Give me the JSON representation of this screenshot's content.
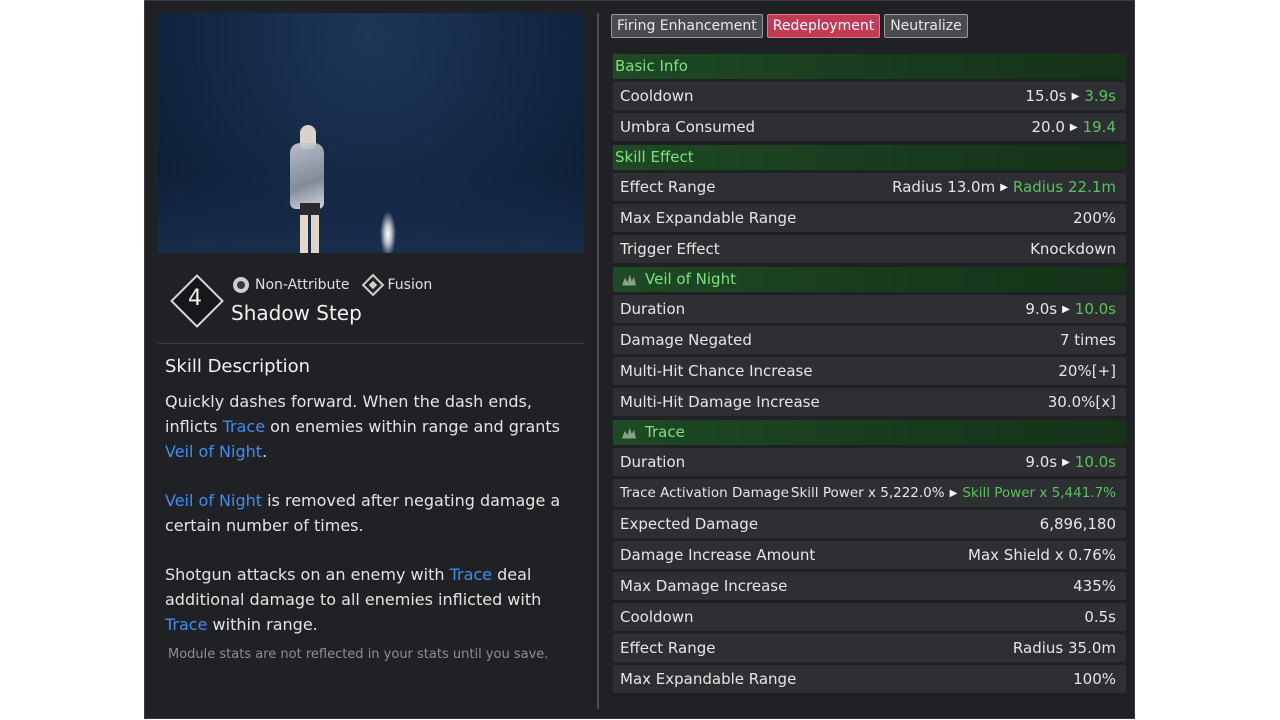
{
  "skill": {
    "level": "4",
    "attribute": "Non-Attribute",
    "type": "Fusion",
    "name": "Shadow Step"
  },
  "description": {
    "title": "Skill Description",
    "p1": [
      "Quickly dashes forward. When the dash ends, inflicts ",
      "Trace",
      " on enemies within range and grants ",
      "Veil of Night",
      "."
    ],
    "p2": [
      "Veil of Night",
      " is removed after negating damage a certain number of times."
    ],
    "p3": [
      "Shotgun attacks on an enemy with ",
      "Trace",
      " deal additional damage to all enemies inflicted with ",
      "Trace",
      " within range."
    ],
    "note": "Module stats are not reflected in your stats until you save."
  },
  "tabs": [
    {
      "label": "Firing Enhancement",
      "active": false
    },
    {
      "label": "Redeployment",
      "active": true
    },
    {
      "label": "Neutralize",
      "active": false
    }
  ],
  "sections": [
    {
      "title": "Basic Info",
      "icon": "",
      "rows": [
        {
          "label": "Cooldown",
          "value": "15.0s",
          "new": "3.9s"
        },
        {
          "label": "Umbra Consumed",
          "value": "20.0",
          "new": "19.4"
        }
      ]
    },
    {
      "title": "Skill Effect",
      "icon": "",
      "rows": [
        {
          "label": "Effect Range",
          "value": "Radius 13.0m",
          "new": "Radius 22.1m"
        },
        {
          "label": "Max Expandable Range",
          "value": "200%"
        },
        {
          "label": "Trigger Effect",
          "value": "Knockdown"
        }
      ]
    },
    {
      "title": "Veil of Night",
      "icon": "veil-of-night-icon",
      "rows": [
        {
          "label": "Duration",
          "value": "9.0s",
          "new": "10.0s"
        },
        {
          "label": "Damage Negated",
          "value": "7 times"
        },
        {
          "label": "Multi-Hit Chance Increase",
          "value": "20%[+]"
        },
        {
          "label": "Multi-Hit Damage Increase",
          "value": "30.0%[x]"
        }
      ]
    },
    {
      "title": "Trace",
      "icon": "trace-icon",
      "rows": [
        {
          "label": "Duration",
          "value": "9.0s",
          "new": "10.0s"
        },
        {
          "label": "Trace Activation Damage",
          "value": "Skill Power x 5,222.0%",
          "new": "Skill Power x 5,441.7%",
          "small": true
        },
        {
          "label": "Expected Damage",
          "value": "6,896,180"
        },
        {
          "label": "Damage Increase Amount",
          "value": "Max Shield x 0.76%"
        },
        {
          "label": "Max Damage Increase",
          "value": "435%"
        },
        {
          "label": "Cooldown",
          "value": "0.5s"
        },
        {
          "label": "Effect Range",
          "value": "Radius 35.0m"
        },
        {
          "label": "Max Expandable Range",
          "value": "100%"
        }
      ]
    }
  ],
  "colors": {
    "accent_keyword": "#3d8ef0",
    "improved_value": "#58c35a",
    "section_header": "#7fe07f",
    "active_tab": "#c23a55"
  }
}
